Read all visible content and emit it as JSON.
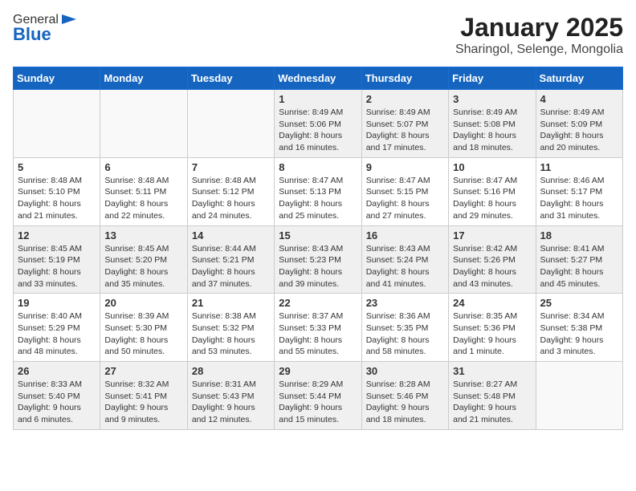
{
  "header": {
    "logo_general": "General",
    "logo_blue": "Blue",
    "title": "January 2025",
    "subtitle": "Sharingol, Selenge, Mongolia"
  },
  "weekdays": [
    "Sunday",
    "Monday",
    "Tuesday",
    "Wednesday",
    "Thursday",
    "Friday",
    "Saturday"
  ],
  "weeks": [
    [
      {
        "day": "",
        "info": ""
      },
      {
        "day": "",
        "info": ""
      },
      {
        "day": "",
        "info": ""
      },
      {
        "day": "1",
        "info": "Sunrise: 8:49 AM\nSunset: 5:06 PM\nDaylight: 8 hours\nand 16 minutes."
      },
      {
        "day": "2",
        "info": "Sunrise: 8:49 AM\nSunset: 5:07 PM\nDaylight: 8 hours\nand 17 minutes."
      },
      {
        "day": "3",
        "info": "Sunrise: 8:49 AM\nSunset: 5:08 PM\nDaylight: 8 hours\nand 18 minutes."
      },
      {
        "day": "4",
        "info": "Sunrise: 8:49 AM\nSunset: 5:09 PM\nDaylight: 8 hours\nand 20 minutes."
      }
    ],
    [
      {
        "day": "5",
        "info": "Sunrise: 8:48 AM\nSunset: 5:10 PM\nDaylight: 8 hours\nand 21 minutes."
      },
      {
        "day": "6",
        "info": "Sunrise: 8:48 AM\nSunset: 5:11 PM\nDaylight: 8 hours\nand 22 minutes."
      },
      {
        "day": "7",
        "info": "Sunrise: 8:48 AM\nSunset: 5:12 PM\nDaylight: 8 hours\nand 24 minutes."
      },
      {
        "day": "8",
        "info": "Sunrise: 8:47 AM\nSunset: 5:13 PM\nDaylight: 8 hours\nand 25 minutes."
      },
      {
        "day": "9",
        "info": "Sunrise: 8:47 AM\nSunset: 5:15 PM\nDaylight: 8 hours\nand 27 minutes."
      },
      {
        "day": "10",
        "info": "Sunrise: 8:47 AM\nSunset: 5:16 PM\nDaylight: 8 hours\nand 29 minutes."
      },
      {
        "day": "11",
        "info": "Sunrise: 8:46 AM\nSunset: 5:17 PM\nDaylight: 8 hours\nand 31 minutes."
      }
    ],
    [
      {
        "day": "12",
        "info": "Sunrise: 8:45 AM\nSunset: 5:19 PM\nDaylight: 8 hours\nand 33 minutes."
      },
      {
        "day": "13",
        "info": "Sunrise: 8:45 AM\nSunset: 5:20 PM\nDaylight: 8 hours\nand 35 minutes."
      },
      {
        "day": "14",
        "info": "Sunrise: 8:44 AM\nSunset: 5:21 PM\nDaylight: 8 hours\nand 37 minutes."
      },
      {
        "day": "15",
        "info": "Sunrise: 8:43 AM\nSunset: 5:23 PM\nDaylight: 8 hours\nand 39 minutes."
      },
      {
        "day": "16",
        "info": "Sunrise: 8:43 AM\nSunset: 5:24 PM\nDaylight: 8 hours\nand 41 minutes."
      },
      {
        "day": "17",
        "info": "Sunrise: 8:42 AM\nSunset: 5:26 PM\nDaylight: 8 hours\nand 43 minutes."
      },
      {
        "day": "18",
        "info": "Sunrise: 8:41 AM\nSunset: 5:27 PM\nDaylight: 8 hours\nand 45 minutes."
      }
    ],
    [
      {
        "day": "19",
        "info": "Sunrise: 8:40 AM\nSunset: 5:29 PM\nDaylight: 8 hours\nand 48 minutes."
      },
      {
        "day": "20",
        "info": "Sunrise: 8:39 AM\nSunset: 5:30 PM\nDaylight: 8 hours\nand 50 minutes."
      },
      {
        "day": "21",
        "info": "Sunrise: 8:38 AM\nSunset: 5:32 PM\nDaylight: 8 hours\nand 53 minutes."
      },
      {
        "day": "22",
        "info": "Sunrise: 8:37 AM\nSunset: 5:33 PM\nDaylight: 8 hours\nand 55 minutes."
      },
      {
        "day": "23",
        "info": "Sunrise: 8:36 AM\nSunset: 5:35 PM\nDaylight: 8 hours\nand 58 minutes."
      },
      {
        "day": "24",
        "info": "Sunrise: 8:35 AM\nSunset: 5:36 PM\nDaylight: 9 hours\nand 1 minute."
      },
      {
        "day": "25",
        "info": "Sunrise: 8:34 AM\nSunset: 5:38 PM\nDaylight: 9 hours\nand 3 minutes."
      }
    ],
    [
      {
        "day": "26",
        "info": "Sunrise: 8:33 AM\nSunset: 5:40 PM\nDaylight: 9 hours\nand 6 minutes."
      },
      {
        "day": "27",
        "info": "Sunrise: 8:32 AM\nSunset: 5:41 PM\nDaylight: 9 hours\nand 9 minutes."
      },
      {
        "day": "28",
        "info": "Sunrise: 8:31 AM\nSunset: 5:43 PM\nDaylight: 9 hours\nand 12 minutes."
      },
      {
        "day": "29",
        "info": "Sunrise: 8:29 AM\nSunset: 5:44 PM\nDaylight: 9 hours\nand 15 minutes."
      },
      {
        "day": "30",
        "info": "Sunrise: 8:28 AM\nSunset: 5:46 PM\nDaylight: 9 hours\nand 18 minutes."
      },
      {
        "day": "31",
        "info": "Sunrise: 8:27 AM\nSunset: 5:48 PM\nDaylight: 9 hours\nand 21 minutes."
      },
      {
        "day": "",
        "info": ""
      }
    ]
  ]
}
